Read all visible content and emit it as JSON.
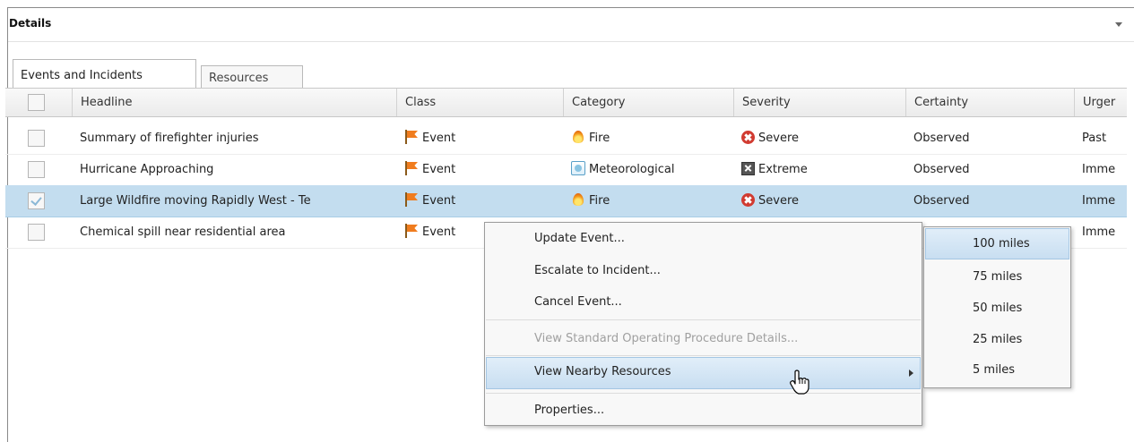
{
  "panel": {
    "title": "Details"
  },
  "tabs": [
    {
      "label": "Events and Incidents"
    },
    {
      "label": "Resources"
    }
  ],
  "grid": {
    "columns": [
      "Headline",
      "Class",
      "Category",
      "Severity",
      "Certainty",
      "Urger"
    ],
    "rows": [
      {
        "headline": "Summary of firefighter injuries",
        "class": "Event",
        "class_icon": "flag-icon",
        "category": "Fire",
        "category_icon": "fire-icon",
        "severity": "Severe",
        "severity_icon": "severe-icon",
        "certainty": "Observed",
        "urgency": "Past",
        "checked": false,
        "selected": false
      },
      {
        "headline": "Hurricane Approaching",
        "class": "Event",
        "class_icon": "flag-icon",
        "category": "Meteorological",
        "category_icon": "meteorological-icon",
        "severity": "Extreme",
        "severity_icon": "extreme-icon",
        "certainty": "Observed",
        "urgency": "Imme",
        "checked": false,
        "selected": false
      },
      {
        "headline": "Large Wildfire moving Rapidly West - Te",
        "class": "Event",
        "class_icon": "flag-icon",
        "category": "Fire",
        "category_icon": "fire-icon",
        "severity": "Severe",
        "severity_icon": "severe-icon",
        "certainty": "Observed",
        "urgency": "Imme",
        "checked": true,
        "selected": true
      },
      {
        "headline": "Chemical spill near residential area",
        "class": "Event",
        "class_icon": "flag-icon",
        "certainty": "",
        "urgency": "Imme",
        "checked": false,
        "selected": false
      }
    ]
  },
  "context_menu": {
    "items": [
      {
        "label": "Update Event..."
      },
      {
        "label": "Escalate to Incident..."
      },
      {
        "label": "Cancel Event..."
      },
      {
        "label": "View Standard Operating Procedure Details...",
        "disabled": true
      },
      {
        "label": "View Nearby Resources",
        "active": true,
        "has_submenu": true
      },
      {
        "label": "Properties..."
      }
    ]
  },
  "submenu": {
    "items": [
      {
        "label": "100 miles",
        "active": true
      },
      {
        "label": "75 miles"
      },
      {
        "label": "50 miles"
      },
      {
        "label": "25 miles"
      },
      {
        "label": "5 miles"
      }
    ]
  },
  "colors": {
    "selected_row": "#c3ddef",
    "menu_highlight": "#c8def1",
    "event_flag": "#f07c1e",
    "severe": "#d13b31"
  }
}
